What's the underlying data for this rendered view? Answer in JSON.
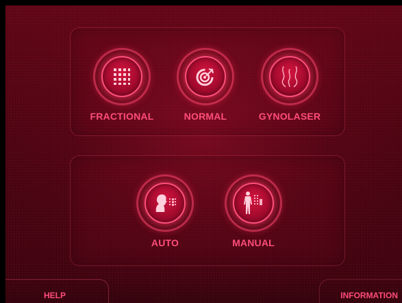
{
  "modes_top": [
    {
      "id": "fractional",
      "label": "FRACTIONAL",
      "icon": "grid-icon"
    },
    {
      "id": "normal",
      "label": "NORMAL",
      "icon": "target-icon"
    },
    {
      "id": "gynolaser",
      "label": "GYNOLASER",
      "icon": "gynolaser-icon"
    }
  ],
  "modes_bottom": [
    {
      "id": "auto",
      "label": "AUTO",
      "icon": "head-scan-icon"
    },
    {
      "id": "manual",
      "label": "MANUAL",
      "icon": "body-scan-icon"
    }
  ],
  "footer": {
    "help": "HELP",
    "information": "INFORMATION"
  },
  "colors": {
    "accent": "#ff4d7a",
    "background": "#4c0512",
    "button_fill": "#a10a2d"
  }
}
